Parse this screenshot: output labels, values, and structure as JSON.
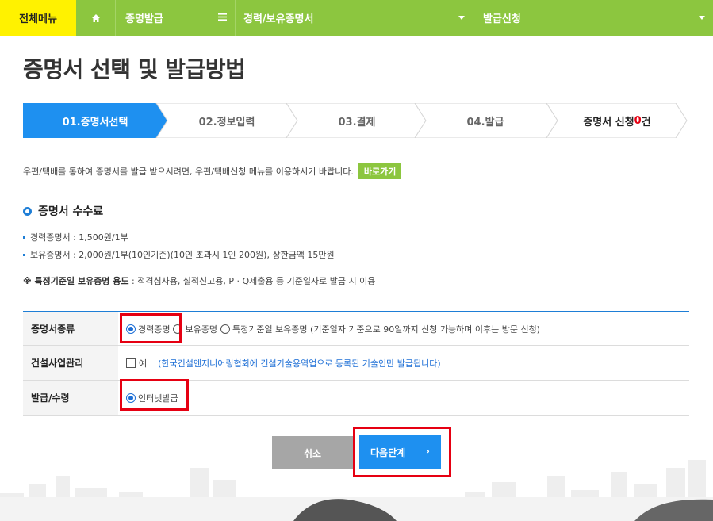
{
  "nav": {
    "all_menu": "전체메뉴",
    "seg1": "증명발급",
    "seg2": "경력/보유증명서",
    "seg3": "발급신청"
  },
  "page_title": "증명서 선택 및 발급방법",
  "steps": {
    "s1": "01.증명서선택",
    "s2": "02.정보입력",
    "s3": "03.결제",
    "s4": "04.발급",
    "s5_prefix": "증명서 신청 ",
    "s5_count": "0",
    "s5_suffix": "건"
  },
  "notice": {
    "text": "우편/택배를 통하여 증명서를 발급 받으시려면, 우편/택배신청 메뉴를 이용하시기 바랍니다.",
    "go_button": "바로가기"
  },
  "fee_section": {
    "title": "증명서 수수료",
    "item1": "경력증명서 : 1,500원/1부",
    "item2": "보유증명서 : 2,000원/1부(10인기준)(10인 초과시 1인 200원), 상한금액 15만원",
    "special_label": "※ 특정기준일 보유증명 용도",
    "special_text": " : 적격심사용, 실적신고용, P · Q제출용 등 기준일자로 발급 시 이용"
  },
  "form": {
    "row1_label": "증명서종류",
    "opt_career": "경력증명",
    "opt_holding": "보유증명",
    "opt_special": "특정기준일 보유증명 (기준일자 기준으로 90일까지 신청 가능하며 이후는 방문 신청)",
    "row2_label": "건설사업관리",
    "chk_yes": "예",
    "row2_note": "(한국건설엔지니어링협회에 건설기술용역업으로 등록된 기술인만 발급됩니다)",
    "row3_label": "발급/수령",
    "opt_internet": "인터넷발급"
  },
  "buttons": {
    "cancel": "취소",
    "next": "다음단계"
  },
  "colors": {
    "nav_green": "#8cc63f",
    "all_menu_yellow": "#fff200",
    "primary_blue": "#1e90f0",
    "highlight_red": "#e60012"
  }
}
